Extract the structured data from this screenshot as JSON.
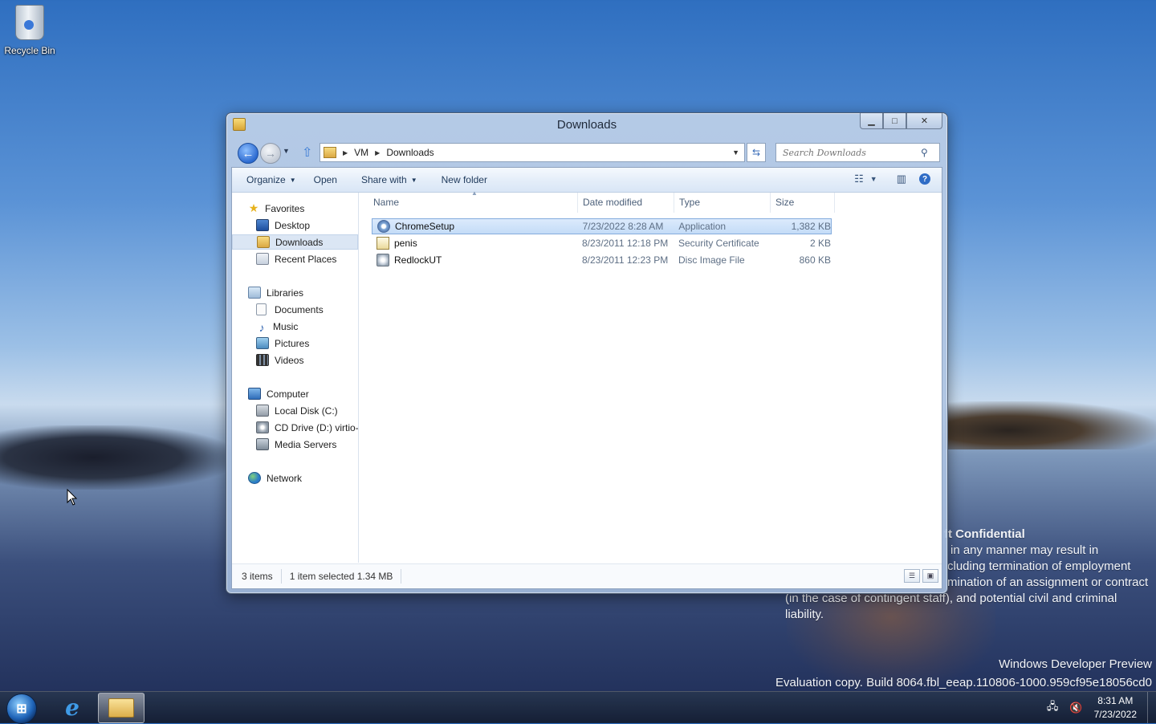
{
  "desktop": {
    "icons": [
      {
        "label": "Recycle Bin",
        "icon": "recycle-bin-icon"
      }
    ],
    "watermark": {
      "confidential_title": "ft Confidential",
      "confidential_lines": [
        "in any manner may result in",
        "cluding termination of employment",
        "mination of an assignment or contract",
        "(in the case of contingent staff), and potential civil and criminal",
        "liability."
      ],
      "edition": "Windows Developer Preview",
      "build": "Evaluation copy. Build 8064.fbl_eeap.110806-1000.959cf95e18056cd0"
    }
  },
  "window": {
    "title": "Downloads",
    "caption": {
      "minimize": "▭",
      "maximize": "□",
      "close": "✕"
    },
    "address": {
      "crumbs": [
        "VM",
        "Downloads"
      ]
    },
    "search": {
      "placeholder": "Search Downloads"
    },
    "commands": {
      "organize": "Organize",
      "open": "Open",
      "share_with": "Share with",
      "new_folder": "New folder"
    },
    "nav": {
      "favorites": "Favorites",
      "desktop": "Desktop",
      "downloads": "Downloads",
      "recent_places": "Recent Places",
      "libraries": "Libraries",
      "documents": "Documents",
      "music": "Music",
      "pictures": "Pictures",
      "videos": "Videos",
      "computer": "Computer",
      "local_disk": "Local Disk (C:)",
      "cd_drive": "CD Drive (D:) virtio-w",
      "media_servers": "Media Servers",
      "network": "Network"
    },
    "columns": {
      "name": "Name",
      "date": "Date modified",
      "type": "Type",
      "size": "Size"
    },
    "files": [
      {
        "name": "ChromeSetup",
        "date": "7/23/2022 8:28 AM",
        "type": "Application",
        "size": "1,382 KB",
        "icon": "application-icon",
        "selected": true
      },
      {
        "name": "penis",
        "date": "8/23/2011 12:18 PM",
        "type": "Security Certificate",
        "size": "2 KB",
        "icon": "certificate-icon",
        "selected": false
      },
      {
        "name": "RedlockUT",
        "date": "8/23/2011 12:23 PM",
        "type": "Disc Image File",
        "size": "860 KB",
        "icon": "disc-image-icon",
        "selected": false
      }
    ],
    "status": {
      "count": "3 items",
      "selection": "1 item selected 1.34 MB"
    }
  },
  "taskbar": {
    "clock_time": "8:31 AM",
    "clock_date": "7/23/2022",
    "pinned": [
      "internet-explorer-icon",
      "windows-explorer-icon"
    ]
  }
}
